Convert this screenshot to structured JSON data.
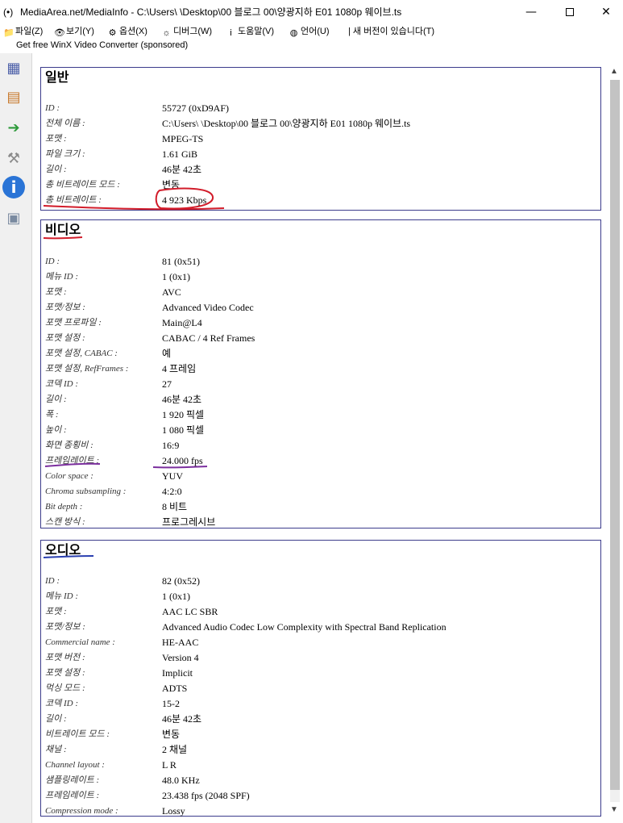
{
  "window": {
    "icon": "(•)",
    "title": "MediaArea.net/MediaInfo - C:\\Users\\ \\Desktop\\00 블로그 00\\양광지하 E01 1080p 웨이브.ts",
    "minimize": "—",
    "close": "✕"
  },
  "menu": [
    {
      "label": "파일(Z)",
      "icon": "file-icon",
      "glyph": "📁"
    },
    {
      "label": "보기(Y)",
      "icon": "view-icon",
      "glyph": "👁"
    },
    {
      "label": "옵션(X)",
      "icon": "options-icon",
      "glyph": "⚙"
    },
    {
      "label": "디버그(W)",
      "icon": "debug-icon",
      "glyph": "☼"
    },
    {
      "label": "도움말(V)",
      "icon": "help-icon",
      "glyph": "i"
    },
    {
      "label": "언어(U)",
      "icon": "language-icon",
      "glyph": "◍"
    },
    {
      "label": "| 새 버전이 있습니다(T)",
      "icon": "",
      "glyph": ""
    }
  ],
  "sponsor": "Get free WinX Video Converter (sponsored)",
  "scrollbar": {
    "up": "▲",
    "down": "▼"
  },
  "toolbar": [
    {
      "name": "open-file-icon",
      "glyph": "▦",
      "color": "#4a5ea8"
    },
    {
      "name": "open-folder-icon",
      "glyph": "▤",
      "color": "#c8782a"
    },
    {
      "name": "export-icon",
      "glyph": "➔",
      "color": "#2d9a3a"
    },
    {
      "name": "settings-icon",
      "glyph": "⚒",
      "color": "#8a8a8a"
    },
    {
      "name": "info-icon",
      "glyph": "i",
      "color": "#2a74d6"
    },
    {
      "name": "about-icon",
      "glyph": "▣",
      "color": "#7a8aa0"
    }
  ],
  "sections": [
    {
      "title": "일반",
      "rows": [
        {
          "label": "ID :",
          "value": "55727 (0xD9AF)"
        },
        {
          "label": "전체 이름 :",
          "value": "C:\\Users\\ \\Desktop\\00 블로그 00\\양광지하 E01 1080p 웨이브.ts"
        },
        {
          "label": "포맷 :",
          "value": "MPEG-TS"
        },
        {
          "label": "파일 크기 :",
          "value": "1.61 GiB"
        },
        {
          "label": "길이 :",
          "value": "46분 42초"
        },
        {
          "label": "총 비트레이트 모드 :",
          "value": "변동"
        },
        {
          "label": "총 비트레이트 :",
          "value": "4 923 Kbps"
        }
      ]
    },
    {
      "title": "비디오",
      "rows": [
        {
          "label": "ID :",
          "value": "81 (0x51)"
        },
        {
          "label": "메뉴 ID :",
          "value": "1 (0x1)"
        },
        {
          "label": "포맷 :",
          "value": "AVC"
        },
        {
          "label": "포맷/정보 :",
          "value": "Advanced Video Codec"
        },
        {
          "label": "포맷 프로파일 :",
          "value": "Main@L4"
        },
        {
          "label": "포맷 설정 :",
          "value": "CABAC / 4 Ref Frames"
        },
        {
          "label": "포맷 설정, CABAC :",
          "value": "예"
        },
        {
          "label": "포맷 설정, RefFrames :",
          "value": "4 프레임"
        },
        {
          "label": "코덱 ID :",
          "value": "27"
        },
        {
          "label": "길이 :",
          "value": "46분 42초"
        },
        {
          "label": "폭 :",
          "value": "1 920 픽셀"
        },
        {
          "label": "높이 :",
          "value": "1 080 픽셀"
        },
        {
          "label": "화면 종횡비 :",
          "value": "16:9"
        },
        {
          "label": "프레임레이트 :",
          "value": "24.000 fps"
        },
        {
          "label": "Color space :",
          "value": "YUV"
        },
        {
          "label": "Chroma subsampling :",
          "value": "4:2:0"
        },
        {
          "label": "Bit depth :",
          "value": "8 비트"
        },
        {
          "label": "스캔 방식 :",
          "value": "프로그레시브"
        }
      ]
    },
    {
      "title": "오디오",
      "rows": [
        {
          "label": "ID :",
          "value": "82 (0x52)"
        },
        {
          "label": "메뉴 ID :",
          "value": "1 (0x1)"
        },
        {
          "label": "포맷 :",
          "value": "AAC LC SBR"
        },
        {
          "label": "포맷/정보 :",
          "value": "Advanced Audio Codec Low Complexity with Spectral Band Replication"
        },
        {
          "label": "Commercial name :",
          "value": "HE-AAC"
        },
        {
          "label": "포맷 버전 :",
          "value": "Version 4"
        },
        {
          "label": "포맷 설정 :",
          "value": "Implicit"
        },
        {
          "label": "먹싱 모드 :",
          "value": "ADTS"
        },
        {
          "label": "코덱 ID :",
          "value": "15-2"
        },
        {
          "label": "길이 :",
          "value": "46분 42초"
        },
        {
          "label": "비트레이트 모드 :",
          "value": "변동"
        },
        {
          "label": "채널 :",
          "value": "2 채널"
        },
        {
          "label": "Channel layout :",
          "value": "L R"
        },
        {
          "label": "샘플링레이트 :",
          "value": "48.0 KHz"
        },
        {
          "label": "프레임레이트 :",
          "value": "23.438 fps (2048 SPF)"
        },
        {
          "label": "Compression mode :",
          "value": "Lossy"
        }
      ]
    }
  ],
  "colors": {
    "section_border": "#3c3c8c",
    "annotation_red": "#d21c2a",
    "annotation_purple": "#7b2f9e",
    "annotation_blue": "#2a3fb0"
  }
}
